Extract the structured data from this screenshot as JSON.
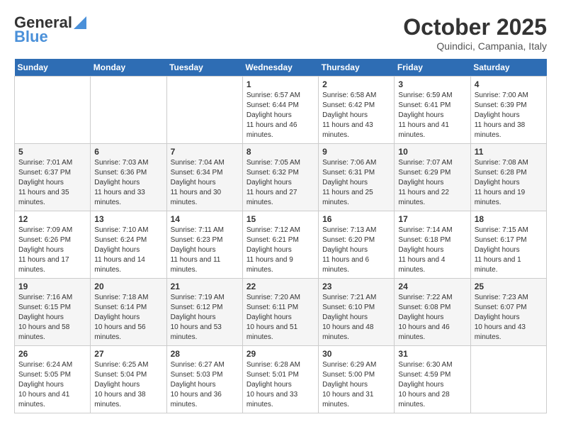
{
  "header": {
    "logo_line1": "General",
    "logo_line2": "Blue",
    "month": "October 2025",
    "location": "Quindici, Campania, Italy"
  },
  "weekdays": [
    "Sunday",
    "Monday",
    "Tuesday",
    "Wednesday",
    "Thursday",
    "Friday",
    "Saturday"
  ],
  "weeks": [
    [
      {
        "day": null
      },
      {
        "day": null
      },
      {
        "day": null
      },
      {
        "day": 1,
        "sunrise": "6:57 AM",
        "sunset": "6:44 PM",
        "daylight": "11 hours and 46 minutes."
      },
      {
        "day": 2,
        "sunrise": "6:58 AM",
        "sunset": "6:42 PM",
        "daylight": "11 hours and 43 minutes."
      },
      {
        "day": 3,
        "sunrise": "6:59 AM",
        "sunset": "6:41 PM",
        "daylight": "11 hours and 41 minutes."
      },
      {
        "day": 4,
        "sunrise": "7:00 AM",
        "sunset": "6:39 PM",
        "daylight": "11 hours and 38 minutes."
      }
    ],
    [
      {
        "day": 5,
        "sunrise": "7:01 AM",
        "sunset": "6:37 PM",
        "daylight": "11 hours and 35 minutes."
      },
      {
        "day": 6,
        "sunrise": "7:03 AM",
        "sunset": "6:36 PM",
        "daylight": "11 hours and 33 minutes."
      },
      {
        "day": 7,
        "sunrise": "7:04 AM",
        "sunset": "6:34 PM",
        "daylight": "11 hours and 30 minutes."
      },
      {
        "day": 8,
        "sunrise": "7:05 AM",
        "sunset": "6:32 PM",
        "daylight": "11 hours and 27 minutes."
      },
      {
        "day": 9,
        "sunrise": "7:06 AM",
        "sunset": "6:31 PM",
        "daylight": "11 hours and 25 minutes."
      },
      {
        "day": 10,
        "sunrise": "7:07 AM",
        "sunset": "6:29 PM",
        "daylight": "11 hours and 22 minutes."
      },
      {
        "day": 11,
        "sunrise": "7:08 AM",
        "sunset": "6:28 PM",
        "daylight": "11 hours and 19 minutes."
      }
    ],
    [
      {
        "day": 12,
        "sunrise": "7:09 AM",
        "sunset": "6:26 PM",
        "daylight": "11 hours and 17 minutes."
      },
      {
        "day": 13,
        "sunrise": "7:10 AM",
        "sunset": "6:24 PM",
        "daylight": "11 hours and 14 minutes."
      },
      {
        "day": 14,
        "sunrise": "7:11 AM",
        "sunset": "6:23 PM",
        "daylight": "11 hours and 11 minutes."
      },
      {
        "day": 15,
        "sunrise": "7:12 AM",
        "sunset": "6:21 PM",
        "daylight": "11 hours and 9 minutes."
      },
      {
        "day": 16,
        "sunrise": "7:13 AM",
        "sunset": "6:20 PM",
        "daylight": "11 hours and 6 minutes."
      },
      {
        "day": 17,
        "sunrise": "7:14 AM",
        "sunset": "6:18 PM",
        "daylight": "11 hours and 4 minutes."
      },
      {
        "day": 18,
        "sunrise": "7:15 AM",
        "sunset": "6:17 PM",
        "daylight": "11 hours and 1 minute."
      }
    ],
    [
      {
        "day": 19,
        "sunrise": "7:16 AM",
        "sunset": "6:15 PM",
        "daylight": "10 hours and 58 minutes."
      },
      {
        "day": 20,
        "sunrise": "7:18 AM",
        "sunset": "6:14 PM",
        "daylight": "10 hours and 56 minutes."
      },
      {
        "day": 21,
        "sunrise": "7:19 AM",
        "sunset": "6:12 PM",
        "daylight": "10 hours and 53 minutes."
      },
      {
        "day": 22,
        "sunrise": "7:20 AM",
        "sunset": "6:11 PM",
        "daylight": "10 hours and 51 minutes."
      },
      {
        "day": 23,
        "sunrise": "7:21 AM",
        "sunset": "6:10 PM",
        "daylight": "10 hours and 48 minutes."
      },
      {
        "day": 24,
        "sunrise": "7:22 AM",
        "sunset": "6:08 PM",
        "daylight": "10 hours and 46 minutes."
      },
      {
        "day": 25,
        "sunrise": "7:23 AM",
        "sunset": "6:07 PM",
        "daylight": "10 hours and 43 minutes."
      }
    ],
    [
      {
        "day": 26,
        "sunrise": "6:24 AM",
        "sunset": "5:05 PM",
        "daylight": "10 hours and 41 minutes."
      },
      {
        "day": 27,
        "sunrise": "6:25 AM",
        "sunset": "5:04 PM",
        "daylight": "10 hours and 38 minutes."
      },
      {
        "day": 28,
        "sunrise": "6:27 AM",
        "sunset": "5:03 PM",
        "daylight": "10 hours and 36 minutes."
      },
      {
        "day": 29,
        "sunrise": "6:28 AM",
        "sunset": "5:01 PM",
        "daylight": "10 hours and 33 minutes."
      },
      {
        "day": 30,
        "sunrise": "6:29 AM",
        "sunset": "5:00 PM",
        "daylight": "10 hours and 31 minutes."
      },
      {
        "day": 31,
        "sunrise": "6:30 AM",
        "sunset": "4:59 PM",
        "daylight": "10 hours and 28 minutes."
      },
      {
        "day": null
      }
    ]
  ],
  "labels": {
    "sunrise": "Sunrise:",
    "sunset": "Sunset:",
    "daylight": "Daylight hours"
  }
}
